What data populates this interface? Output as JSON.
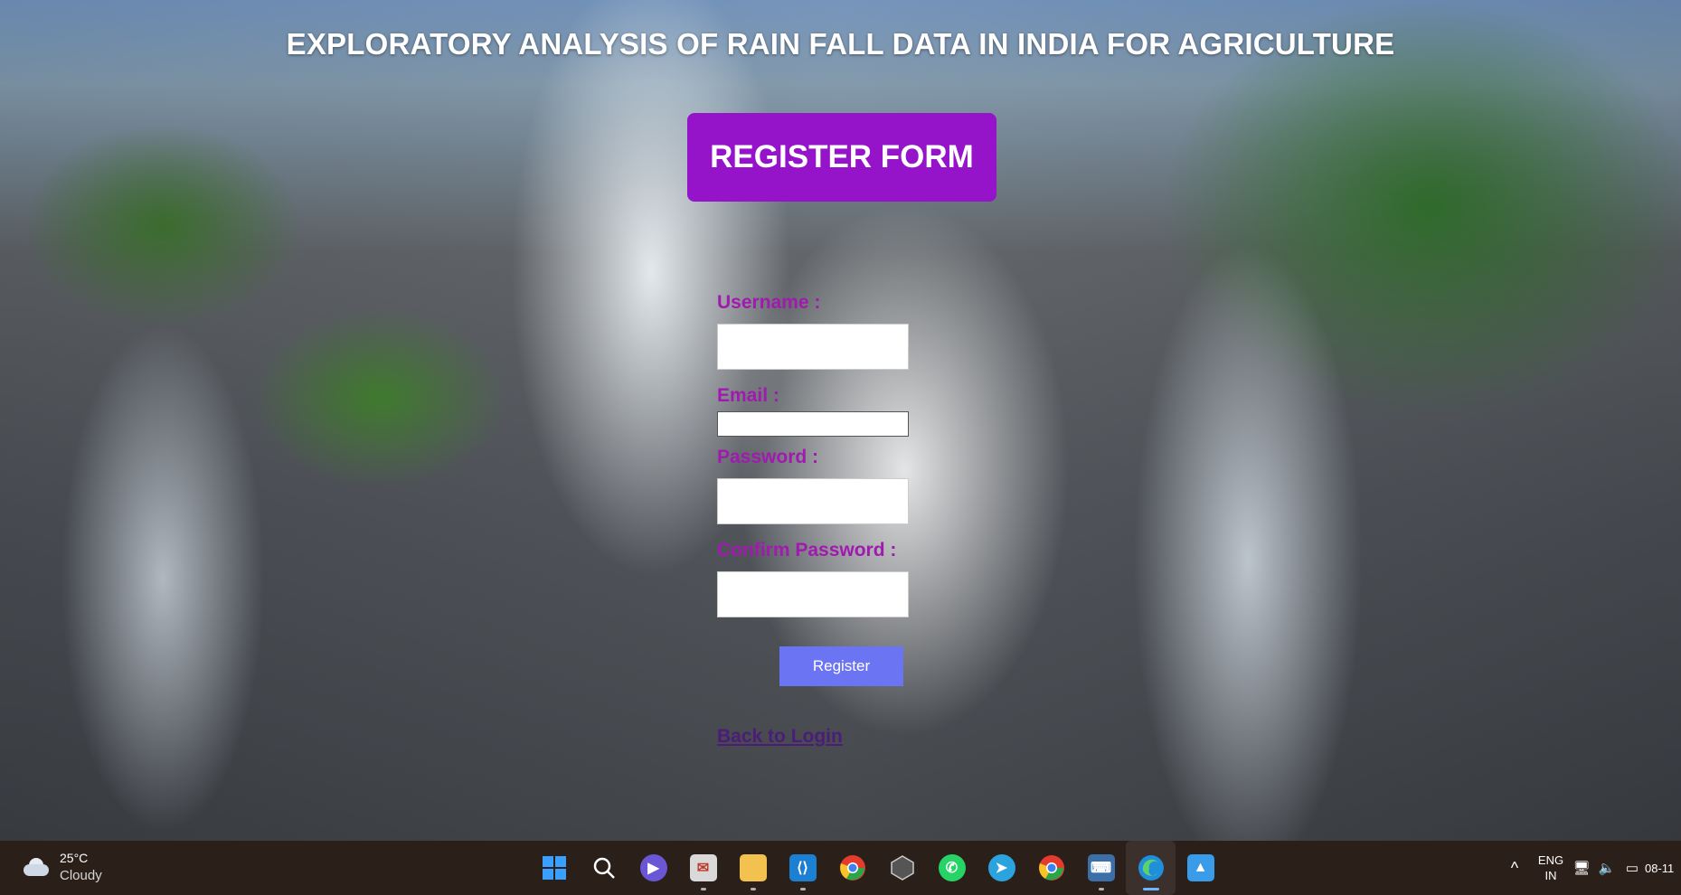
{
  "page": {
    "title": "EXPLORATORY ANALYSIS OF RAIN FALL DATA IN INDIA FOR AGRICULTURE",
    "form_heading": "REGISTER FORM"
  },
  "form": {
    "username_label": "Username :",
    "username_value": "",
    "email_label": "Email :",
    "email_value": "",
    "password_label": "Password :",
    "password_value": "",
    "confirm_password_label": "Confirm Password :",
    "confirm_password_value": "",
    "register_button": "Register",
    "back_link": "Back to Login"
  },
  "taskbar": {
    "weather": {
      "temperature": "25°C",
      "condition": "Cloudy"
    },
    "apps": [
      {
        "name": "windows-start-icon"
      },
      {
        "name": "search-icon"
      },
      {
        "name": "teams-meet-icon"
      },
      {
        "name": "mail-icon"
      },
      {
        "name": "file-explorer-icon"
      },
      {
        "name": "vscode-icon"
      },
      {
        "name": "chrome-icon"
      },
      {
        "name": "app-hexagon-icon"
      },
      {
        "name": "whatsapp-icon"
      },
      {
        "name": "telegram-icon"
      },
      {
        "name": "chrome-icon"
      },
      {
        "name": "python-idle-icon"
      },
      {
        "name": "edge-icon"
      },
      {
        "name": "photos-icon"
      }
    ],
    "tray": {
      "chevron": "^",
      "lang_line1": "ENG",
      "lang_line2": "IN",
      "clock": "08-11"
    }
  },
  "colors": {
    "accent_purple": "#9513c9",
    "label_magenta": "#a11ab0",
    "register_button": "#6b74f2",
    "link": "#4b1c78",
    "taskbar": "#2b1f1a"
  }
}
